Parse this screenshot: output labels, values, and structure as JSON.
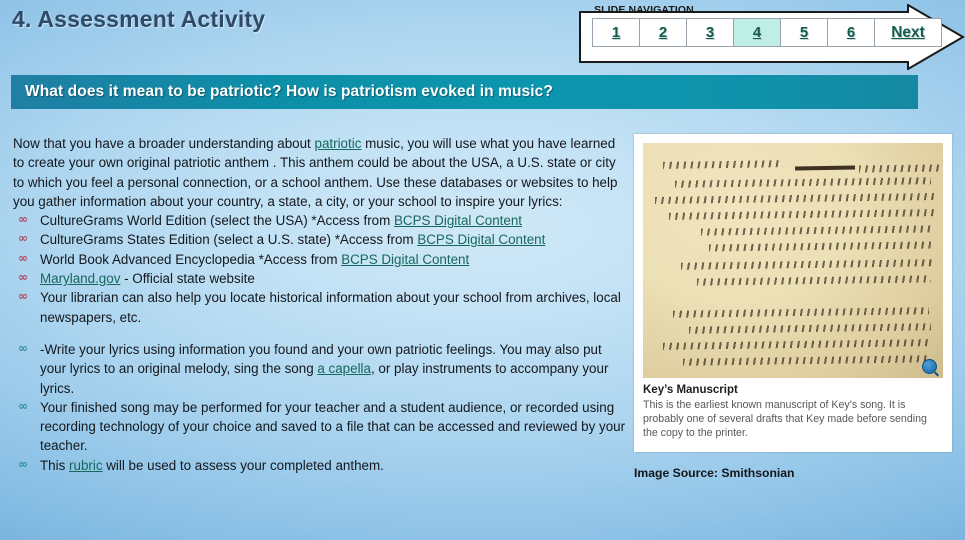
{
  "slide": {
    "title": "4. Assessment Activity",
    "banner": "What does it mean to be patriotic?  How is patriotism evoked in music?"
  },
  "navigation": {
    "label": "SLIDE NAVIGATION",
    "items": [
      {
        "label": "1",
        "selected": false
      },
      {
        "label": "2",
        "selected": false
      },
      {
        "label": "3",
        "selected": false
      },
      {
        "label": "4",
        "selected": true
      },
      {
        "label": "5",
        "selected": false
      },
      {
        "label": "6",
        "selected": false
      }
    ],
    "next_label": "Next",
    "selected_slide": "4",
    "highlight_color": "#bfeee6",
    "link_color": "#115c4e"
  },
  "body": {
    "intro_1": "Now that you have a broader understanding about ",
    "intro_link": "patriotic",
    "intro_2": " music, you will use what you have learned to create your own original patriotic anthem . This anthem  could be about the USA, a U.S. state or city to which you feel a personal connection, or a school anthem. Use these databases or websites to help you gather information about your country, a state, a city, or your school to inspire your lyrics:",
    "resources": [
      {
        "text_before": "CultureGrams World Edition (select the USA) *Access from ",
        "link": "BCPS Digital Content",
        "text_after": ""
      },
      {
        "text_before": "CultureGrams States Edition (select a U.S. state) *Access from ",
        "link": "BCPS Digital Content",
        "text_after": ""
      },
      {
        "text_before": "World Book Advanced Encyclopedia *Access from ",
        "link": "BCPS Digital Content",
        "text_after": ""
      },
      {
        "text_before": "",
        "link": "Maryland.gov",
        "text_after": " - Official state website"
      },
      {
        "text_before": "Your librarian can also help you locate historical information about your school from archives, local newspapers, etc.",
        "link": "",
        "text_after": ""
      }
    ],
    "tasks": [
      {
        "text_before": "-Write your lyrics using information you found and your own patriotic feelings. You may also put your lyrics to an original melody, sing the song ",
        "link": "a capella",
        "text_after": ", or play instruments to accompany your lyrics."
      },
      {
        "text_before": "Your finished song may be performed for your teacher and a student audience, or recorded using recording technology of your choice and saved to a file that can be accessed and reviewed by your teacher.",
        "link": "",
        "text_after": ""
      },
      {
        "text_before": "This ",
        "link": "rubric",
        "text_after": " will be used to assess your completed anthem."
      }
    ],
    "bullet_glyph_resources": "∞",
    "bullet_glyph_tasks": "∞",
    "link_color": "#15685c"
  },
  "image": {
    "caption_title": "Key’s Manuscript",
    "caption_body": "This is the earliest known manuscript of Key’s song. It is probably one of several drafts that Key made before sending the copy to the printer.",
    "source": "Image Source: Smithsonian",
    "magnify_icon": "magnifier-icon"
  }
}
